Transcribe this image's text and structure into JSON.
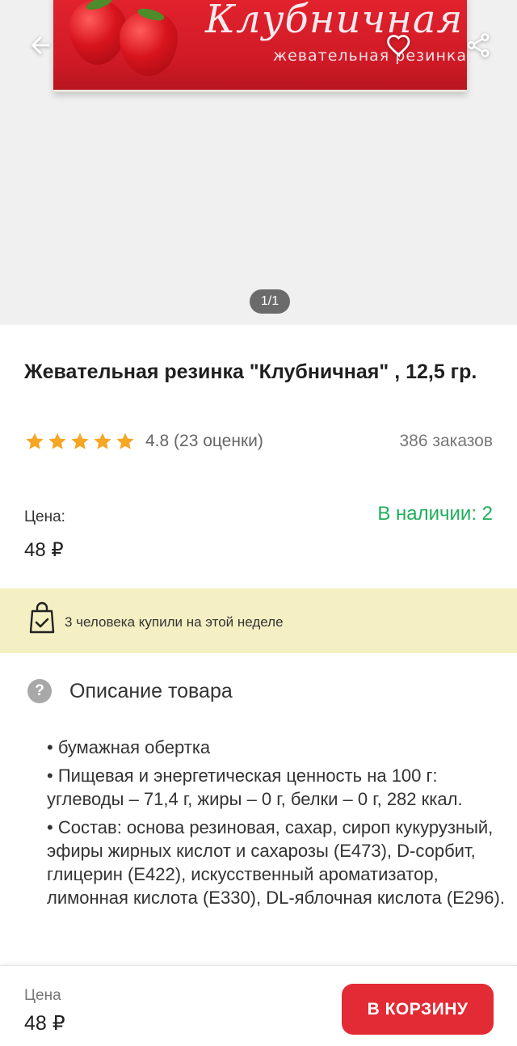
{
  "hero": {
    "pack_title": "Клубничная",
    "pack_subtitle": "жевательная резинка",
    "pager": "1/1"
  },
  "icons": {
    "back": "arrow-left-icon",
    "favorite": "heart-icon",
    "share": "share-icon",
    "star": "star-icon",
    "bag": "shopping-bag-check-icon",
    "help": "question-circle-icon"
  },
  "product": {
    "title": "Жевательная резинка \"Клубничная\" , 12,5 гр.",
    "rating_text": "4.8 (23 оценки)",
    "rating_value": 4.8,
    "orders": "386 заказов",
    "price_label": "Цена:",
    "price": "48 ₽",
    "stock": "В наличии: 2"
  },
  "banner": {
    "text": "3 человека купили на этой неделе"
  },
  "description": {
    "title": "Описание товара",
    "items": [
      "• бумажная обертка",
      "• Пищевая и энергетическая ценность на 100 г: углеводы – 71,4 г, жиры – 0 г, белки – 0 г, 282 ккал.",
      "• Состав: основа резиновая, сахар, сироп кукурузный, эфиры жирных кислот и сахарозы (E473), D-сорбит, глицерин (E422), искусственный ароматизатор, лимонная кислота (E330), DL-яблочная кислота (E296)."
    ]
  },
  "bottom_bar": {
    "price_label": "Цена",
    "price": "48 ₽",
    "cart_button": "В КОРЗИНУ"
  },
  "colors": {
    "accent": "#e32b35",
    "in_stock": "#1fae5a",
    "star": "#f5a623",
    "banner_bg": "#f5f0c4"
  }
}
